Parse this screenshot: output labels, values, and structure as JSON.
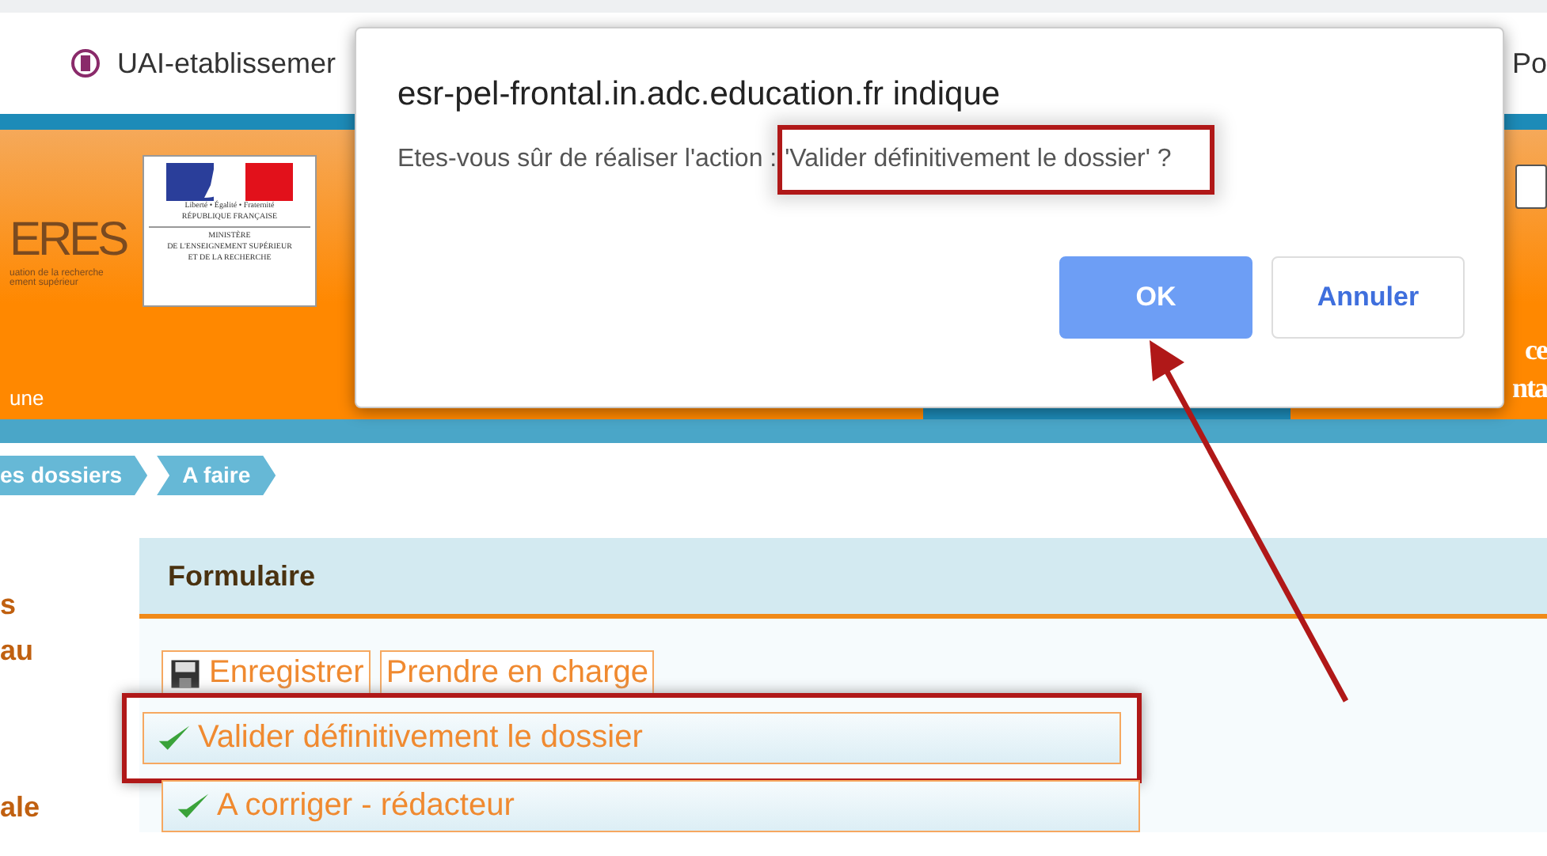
{
  "browser_tab": {
    "title": "UAI-etablissemer",
    "title_right": "Po"
  },
  "banner": {
    "logo_text": "ERES",
    "subtitle_lines": [
      "uation de la recherche",
      "ement supérieur"
    ],
    "emblem_lines": [
      "Liberté • Égalité • Fraternité",
      "RÉPUBLIQUE FRANÇAISE"
    ],
    "ministry_lines": [
      "MINISTÈRE",
      "DE L'ENSEIGNEMENT SUPÉRIEUR",
      "ET DE LA RECHERCHE"
    ],
    "caption": "une",
    "right_lines": [
      "ce",
      "nta"
    ]
  },
  "breadcrumbs": [
    "es dossiers",
    "A faire"
  ],
  "sidebar": [
    "s",
    "au",
    "ale"
  ],
  "panel": {
    "title": "Formulaire",
    "actions": [
      {
        "label": "Enregistrer",
        "kind": "save"
      },
      {
        "label": "Prendre en charge",
        "kind": "plain"
      }
    ],
    "rows": [
      {
        "label": "Valider définitivement le dossier",
        "highlighted": true
      },
      {
        "label": "A corriger - rédacteur",
        "highlighted": false
      }
    ]
  },
  "dialog": {
    "title": "esr-pel-frontal.in.adc.education.fr indique",
    "message_prefix": "Etes-vous sûr de réaliser l'action : ",
    "message_quoted": "'Valider définitivement le dossier' ?",
    "buttons": [
      {
        "label": "OK",
        "primary": true
      },
      {
        "label": "Annuler",
        "primary": false
      }
    ]
  }
}
